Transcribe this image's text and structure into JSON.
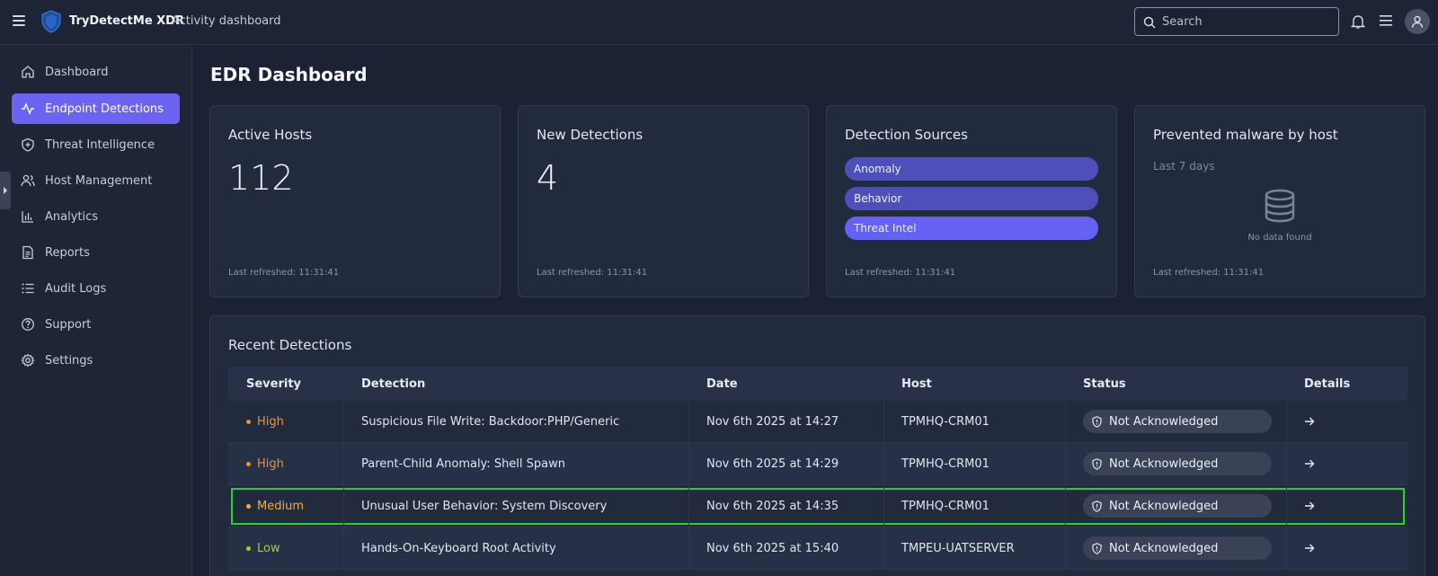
{
  "header": {
    "app_name": "TryDetectMe XDR",
    "subtitle": "Activity dashboard",
    "search_placeholder": "Search"
  },
  "sidebar": {
    "items": [
      {
        "label": "Dashboard",
        "icon": "home-icon"
      },
      {
        "label": "Endpoint Detections",
        "icon": "activity-icon",
        "active": true
      },
      {
        "label": "Threat Intelligence",
        "icon": "shield-plus-icon"
      },
      {
        "label": "Host Management",
        "icon": "users-icon"
      },
      {
        "label": "Analytics",
        "icon": "bar-chart-icon"
      },
      {
        "label": "Reports",
        "icon": "file-text-icon"
      },
      {
        "label": "Audit Logs",
        "icon": "list-icon"
      },
      {
        "label": "Support",
        "icon": "help-circle-icon"
      },
      {
        "label": "Settings",
        "icon": "gear-icon"
      }
    ]
  },
  "page": {
    "title": "EDR Dashboard"
  },
  "cards": {
    "active_hosts": {
      "title": "Active Hosts",
      "value": "112",
      "refreshed": "Last refreshed: 11:31:41"
    },
    "new_detections": {
      "title": "New Detections",
      "value": "4",
      "refreshed": "Last refreshed: 11:31:41"
    },
    "detection_sources": {
      "title": "Detection Sources",
      "sources": [
        "Anomaly",
        "Behavior",
        "Threat Intel"
      ],
      "refreshed": "Last refreshed: 11:31:41"
    },
    "prevented_malware": {
      "title": "Prevented malware by host",
      "period": "Last 7 days",
      "empty": "No data found",
      "refreshed": "Last refreshed: 11:31:41"
    }
  },
  "recent": {
    "title": "Recent Detections",
    "columns": [
      "Severity",
      "Detection",
      "Date",
      "Host",
      "Status",
      "Details"
    ],
    "rows": [
      {
        "severity": "High",
        "detection": "Suspicious File Write: Backdoor:PHP/Generic",
        "date": "Nov 6th 2025 at 14:27",
        "host": "TPMHQ-CRM01",
        "status": "Not Acknowledged"
      },
      {
        "severity": "High",
        "detection": "Parent-Child Anomaly: Shell Spawn",
        "date": "Nov 6th 2025 at 14:29",
        "host": "TPMHQ-CRM01",
        "status": "Not Acknowledged"
      },
      {
        "severity": "Medium",
        "detection": "Unusual User Behavior: System Discovery",
        "date": "Nov 6th 2025 at 14:35",
        "host": "TPMHQ-CRM01",
        "status": "Not Acknowledged"
      },
      {
        "severity": "Low",
        "detection": "Hands-On-Keyboard Root Activity",
        "date": "Nov 6th 2025 at 15:40",
        "host": "TMPEU-UATSERVER",
        "status": "Not Acknowledged"
      }
    ]
  },
  "colors": {
    "accent": "#6c63f0",
    "high": "#f0922e",
    "medium": "#f2b03a",
    "low": "#9ad23a",
    "highlight": "#2bd12b"
  }
}
